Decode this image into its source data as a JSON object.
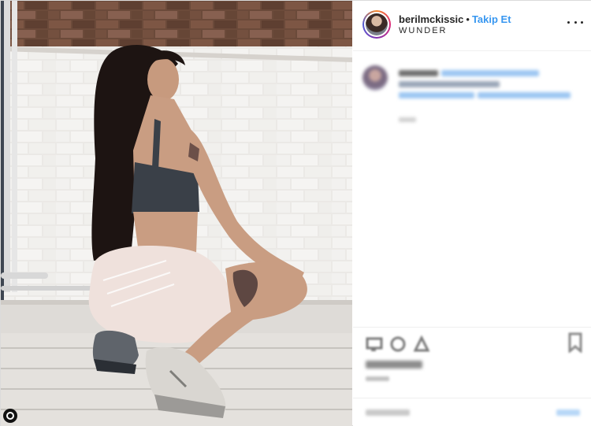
{
  "header": {
    "username": "berilmckissic",
    "separator": "•",
    "follow_label": "Takip Et",
    "location": "WUNDER"
  },
  "icons": {
    "more": "more-options-icon",
    "like": "heart-icon",
    "comment": "comment-icon",
    "share": "share-icon",
    "save": "bookmark-icon"
  },
  "colors": {
    "follow": "#3897f0",
    "text": "#262626",
    "border": "#dbdbdb"
  }
}
